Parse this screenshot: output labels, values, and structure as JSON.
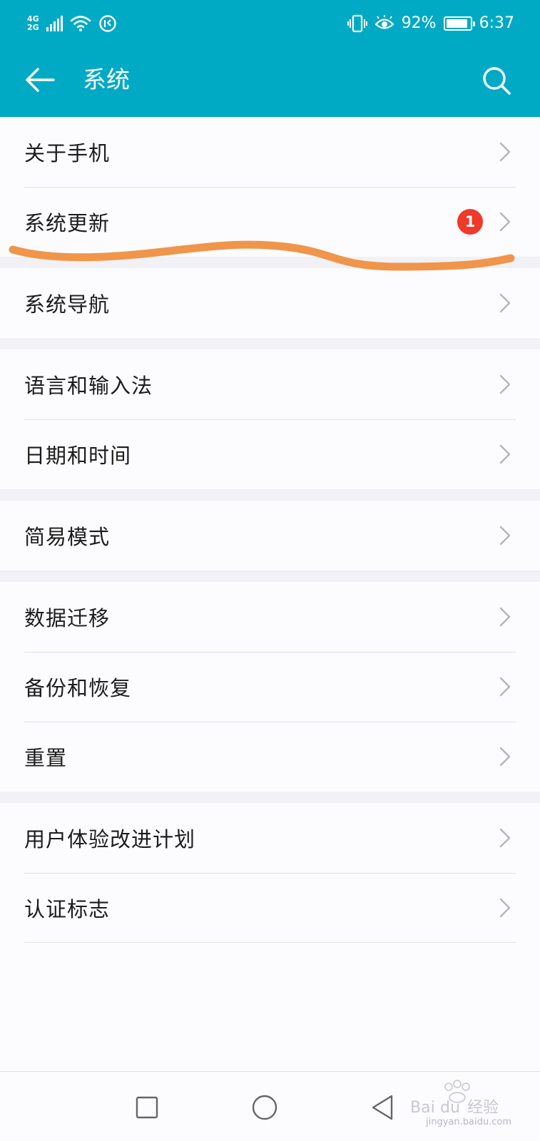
{
  "status_bar": {
    "network_top": "4G",
    "network_bottom": "2G",
    "battery_percent": "92%",
    "battery_level": 0.92,
    "time": "6:37",
    "icons": [
      "signal-icon",
      "wifi-icon",
      "data-saver-icon",
      "vibrate-icon",
      "eye-comfort-icon",
      "battery-icon"
    ]
  },
  "header": {
    "title": "系统",
    "back_icon": "arrow-left-icon",
    "search_icon": "search-icon"
  },
  "groups": [
    {
      "items": [
        {
          "label": "关于手机"
        },
        {
          "label": "系统更新",
          "badge": "1"
        }
      ]
    },
    {
      "items": [
        {
          "label": "系统导航"
        }
      ]
    },
    {
      "items": [
        {
          "label": "语言和输入法"
        },
        {
          "label": "日期和时间"
        }
      ]
    },
    {
      "items": [
        {
          "label": "简易模式"
        }
      ]
    },
    {
      "items": [
        {
          "label": "数据迁移"
        },
        {
          "label": "备份和恢复"
        },
        {
          "label": "重置"
        }
      ]
    },
    {
      "items": [
        {
          "label": "用户体验改进计划"
        },
        {
          "label": "认证标志"
        }
      ]
    }
  ],
  "navbar": {
    "icons": [
      "recent-apps-icon",
      "home-icon",
      "back-triangle-icon"
    ]
  },
  "colors": {
    "header_bg": "#00aac5",
    "badge": "#f0382b",
    "highlight_stroke": "#f0954a"
  },
  "watermark": {
    "text": "jingyan.baidu.com"
  }
}
